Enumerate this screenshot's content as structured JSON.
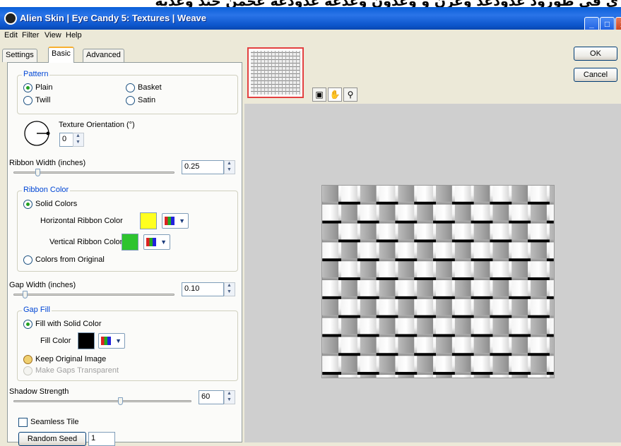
{
  "banner_text": "ي في طورود عدودعد وعرن و وعدون وعدعه عدودعه عجمن جند وعديه",
  "window": {
    "title": "Alien Skin | Eye Candy 5: Textures | Weave",
    "min": "_",
    "max": "□",
    "close": "x"
  },
  "menu": [
    "Edit",
    "Filter",
    "View",
    "Help"
  ],
  "tabs": [
    "Settings",
    "Basic",
    "Advanced"
  ],
  "pattern": {
    "group_label": "Pattern",
    "options": [
      "Plain",
      "Basket",
      "Twill",
      "Satin"
    ],
    "selected": "Plain"
  },
  "texture_orientation": {
    "label": "Texture Orientation (°)",
    "value": "0"
  },
  "ribbon_width": {
    "label": "Ribbon Width (inches)",
    "value": "0.25",
    "fraction": 0.15
  },
  "ribbon_color": {
    "group_label": "Ribbon Color",
    "solid_label": "Solid Colors",
    "horizontal_label": "Horizontal Ribbon Color",
    "horizontal_color": "#ffff20",
    "vertical_label": "Vertical Ribbon Color",
    "vertical_color": "#2ec42e",
    "original_label": "Colors from Original"
  },
  "gap_width": {
    "label": "Gap Width (inches)",
    "value": "0.10",
    "fraction": 0.07
  },
  "gap_fill": {
    "group_label": "Gap Fill",
    "solid_label": "Fill with Solid Color",
    "fill_label": "Fill Color",
    "fill_color": "#000000",
    "keep_label": "Keep Original Image",
    "transparent_label": "Make Gaps Transparent"
  },
  "shadow_strength": {
    "label": "Shadow Strength",
    "value": "60",
    "fraction": 0.6
  },
  "seamless_tile": {
    "label": "Seamless Tile",
    "checked": false
  },
  "random_seed": {
    "label": "Random Seed",
    "value": "1"
  },
  "buttons": {
    "ok": "OK",
    "cancel": "Cancel"
  },
  "tools": {
    "navigator": "navigator-icon",
    "hand": "hand-icon",
    "zoom": "zoom-icon"
  }
}
